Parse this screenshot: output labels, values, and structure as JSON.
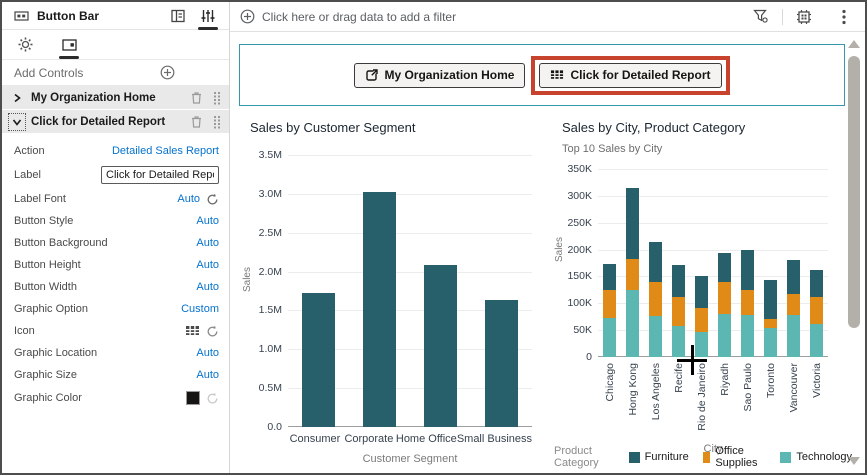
{
  "sidebar": {
    "title": "Button Bar",
    "add_controls_label": "Add Controls",
    "controls": [
      {
        "label": "My Organization Home",
        "state": "collapsed"
      },
      {
        "label": "Click for Detailed Report",
        "state": "expanded"
      }
    ],
    "properties": [
      {
        "label": "Action",
        "value": "Detailed Sales Report"
      },
      {
        "label": "Label",
        "value": "Click for Detailed Report"
      },
      {
        "label": "Label Font",
        "value": "Auto"
      },
      {
        "label": "Button Style",
        "value": "Auto"
      },
      {
        "label": "Button Background",
        "value": "Auto"
      },
      {
        "label": "Button Height",
        "value": "Auto"
      },
      {
        "label": "Button Width",
        "value": "Auto"
      },
      {
        "label": "Graphic Option",
        "value": "Custom"
      },
      {
        "label": "Icon",
        "value": "table-grid-icon"
      },
      {
        "label": "Graphic Location",
        "value": "Auto"
      },
      {
        "label": "Graphic Size",
        "value": "Auto"
      },
      {
        "label": "Graphic Color",
        "value": "#161513"
      }
    ],
    "icons": [
      "button-bar-icon",
      "layout-panel-icon",
      "sliders-icon",
      "gear-icon",
      "control-button-tab-icon",
      "add-circle-icon",
      "trash-icon",
      "grip-icon",
      "reset-icon"
    ]
  },
  "filter_bar": {
    "placeholder": "Click here or drag data to add a filter",
    "icons": [
      "add-filter-icon",
      "filter-funnel-icon",
      "canvas-settings-icon",
      "menu-kebab-icon"
    ]
  },
  "button_bar": {
    "buttons": [
      {
        "label": "My Organization Home",
        "icon": "external-link-icon",
        "annotated": false
      },
      {
        "label": "Click for Detailed Report",
        "icon": "table-grid-icon",
        "annotated": true
      }
    ],
    "annotation_color": "#c7432e",
    "frame_border_color": "#3696ab"
  },
  "chart_data": [
    {
      "type": "bar",
      "title": "Sales by Customer Segment",
      "categories": [
        "Consumer",
        "Corporate",
        "Home Office",
        "Small Business"
      ],
      "values": [
        1720000,
        3030000,
        2080000,
        1630000
      ],
      "xlabel": "Customer Segment",
      "ylabel": "Sales",
      "ylim": [
        0,
        3500000
      ],
      "yticks": [
        "0.0",
        "0.5M",
        "1.0M",
        "1.5M",
        "2.0M",
        "2.5M",
        "3.0M",
        "3.5M"
      ],
      "bar_color": "#275f6b",
      "grid": true,
      "legend": "none"
    },
    {
      "type": "stacked-bar",
      "title": "Sales by City, Product Category",
      "subtitle": "Top 10 Sales by City",
      "categories": [
        "Chicago",
        "Hong Kong",
        "Los Angeles",
        "Recife",
        "Rio de Janeiro",
        "Riyadh",
        "Sao Paulo",
        "Toronto",
        "Vancouver",
        "Victoria"
      ],
      "series": [
        {
          "name": "Technology",
          "color": "#5cb6b2",
          "values": [
            73000,
            125000,
            76000,
            57000,
            47000,
            81000,
            78000,
            54000,
            78000,
            62000
          ]
        },
        {
          "name": "Office Supplies",
          "color": "#e08a18",
          "values": [
            52000,
            57000,
            64000,
            54000,
            44000,
            59000,
            46000,
            17000,
            40000,
            49000
          ]
        },
        {
          "name": "Furniture",
          "color": "#275f6b",
          "values": [
            48000,
            133000,
            74000,
            60000,
            59000,
            53000,
            76000,
            73000,
            62000,
            51000
          ]
        }
      ],
      "xlabel": "City",
      "ylabel": "Sales",
      "ylim": [
        0,
        350000
      ],
      "yticks": [
        "0",
        "50K",
        "100K",
        "150K",
        "200K",
        "250K",
        "300K",
        "350K"
      ],
      "legend_title": "Product Category",
      "legend_order": [
        "Furniture",
        "Office Supplies",
        "Technology"
      ],
      "legend_position": "bottom",
      "grid": true
    }
  ]
}
